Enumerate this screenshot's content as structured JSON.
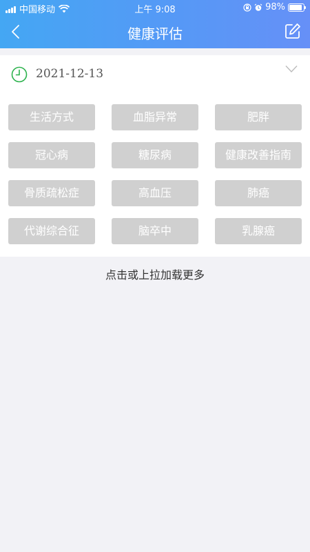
{
  "status_bar": {
    "carrier": "中国移动",
    "time": "上午 9:08",
    "battery_text": "98%",
    "battery_level": 0.98
  },
  "nav": {
    "title": "健康评估",
    "back_icon": "chevron-left-icon",
    "edit_icon": "edit-icon"
  },
  "date_row": {
    "date": "2021-12-13",
    "clock_icon_color": "#2bb24c"
  },
  "tags": [
    "生活方式",
    "血脂异常",
    "肥胖",
    "冠心病",
    "糖尿病",
    "健康改善指南",
    "骨质疏松症",
    "高血压",
    "肺癌",
    "代谢综合征",
    "脑卒中",
    "乳腺癌"
  ],
  "load_more": "点击或上拉加载更多",
  "colors": {
    "header_start": "#44a7f3",
    "header_end": "#6690f7",
    "tag_bg": "#d0d0d0",
    "page_bg": "#f2f2f6"
  }
}
